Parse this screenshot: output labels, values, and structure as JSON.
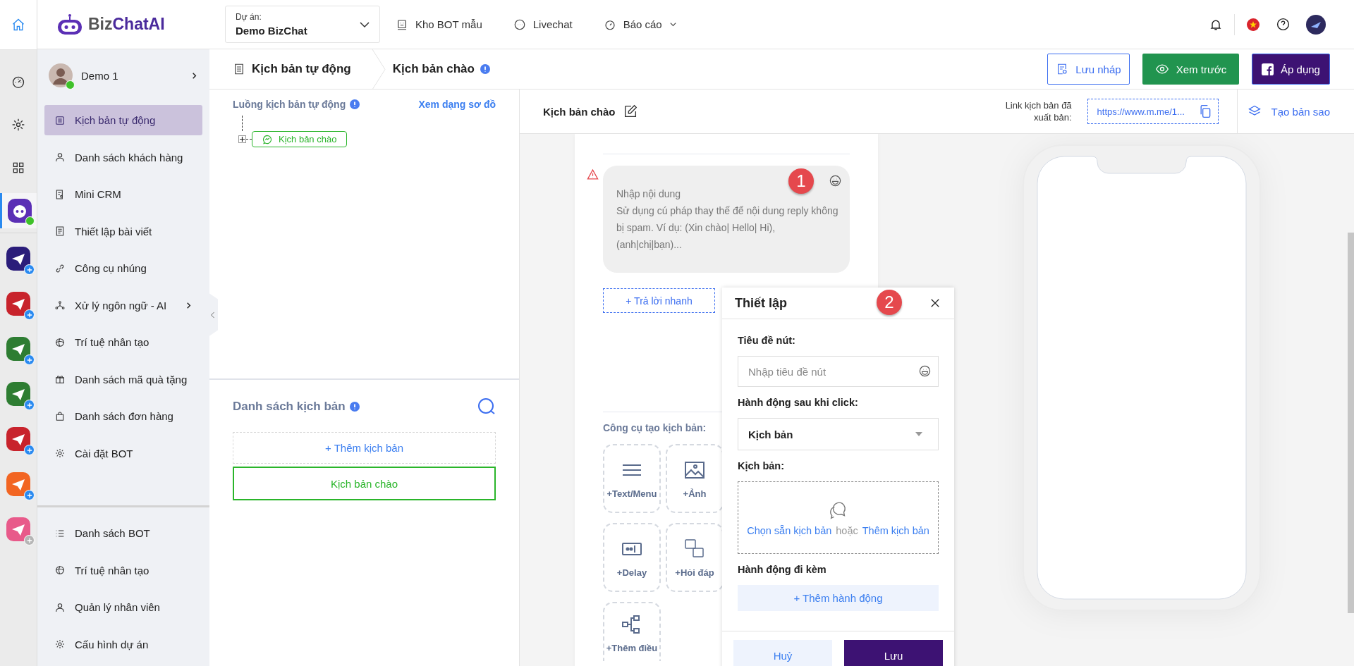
{
  "top_bar": {
    "logo": {
      "part_1": "Biz",
      "part_2": "ChatAI"
    },
    "project": {
      "label": "Dự án:",
      "value": "Demo BizChat"
    },
    "nav": [
      {
        "label": "Kho BOT mẫu",
        "has_menu": false
      },
      {
        "label": "Livechat",
        "has_menu": false
      },
      {
        "label": "Báo cáo",
        "has_menu": true
      }
    ]
  },
  "rail": {
    "tools": [
      {
        "selected": true
      },
      {
        "selected": false
      },
      {
        "selected": false
      },
      {
        "selected": false
      }
    ],
    "apps": [
      {
        "color": "#5b2fb5",
        "selected": true,
        "kind": "online"
      },
      {
        "color": "#2b1d7a",
        "selected": false,
        "kind": "add"
      },
      {
        "color": "#c8232c",
        "selected": false,
        "kind": "add"
      },
      {
        "color": "#2e7d32",
        "selected": false,
        "kind": "add"
      },
      {
        "color": "#2e7d32",
        "selected": false,
        "kind": "add"
      },
      {
        "color": "#c8232c",
        "selected": false,
        "kind": "add"
      },
      {
        "color": "#f26522",
        "selected": false,
        "kind": "add"
      },
      {
        "color": "#e85a8a",
        "selected": false,
        "kind": "disabled"
      }
    ]
  },
  "sidebar": {
    "user": {
      "name": "Demo 1",
      "online": true
    },
    "items": [
      {
        "label": "Kịch bản tự động",
        "selected": true,
        "has_submenu": false
      },
      {
        "label": "Danh sách khách hàng",
        "selected": false,
        "has_submenu": false
      },
      {
        "label": "Mini CRM",
        "selected": false,
        "has_submenu": false
      },
      {
        "label": "Thiết lập bài viết",
        "selected": false,
        "has_submenu": false
      },
      {
        "label": "Công cụ nhúng",
        "selected": false,
        "has_submenu": false
      },
      {
        "label": "Xử lý ngôn ngữ - AI",
        "selected": false,
        "has_submenu": true
      },
      {
        "label": "Trí tuệ nhân tạo",
        "selected": false,
        "has_submenu": false
      },
      {
        "label": "Danh sách mã quà tặng",
        "selected": false,
        "has_submenu": false
      },
      {
        "label": "Danh sách đơn hàng",
        "selected": false,
        "has_submenu": false
      },
      {
        "label": "Cài đặt BOT",
        "selected": false,
        "has_submenu": false
      }
    ],
    "bottom_items": [
      {
        "label": "Danh sách BOT",
        "selected": false
      },
      {
        "label": "Trí tuệ nhân tạo",
        "selected": false
      },
      {
        "label": "Quản lý nhân viên",
        "selected": false
      },
      {
        "label": "Cấu hình dự án",
        "selected": false
      }
    ]
  },
  "breadcrumb": [
    "Kịch bản tự động",
    "Kịch bản chào"
  ],
  "actions": [
    {
      "label": "Lưu nháp",
      "kind": "draft"
    },
    {
      "label": "Xem trước",
      "kind": "preview"
    },
    {
      "label": "Áp dụng",
      "kind": "apply"
    }
  ],
  "flow_panel": {
    "title": "Luồng kịch bản tự động",
    "view_link": "Xem dạng sơ đồ",
    "nodes": [
      {
        "label": "Kịch bản chào"
      }
    ]
  },
  "script_list": {
    "title": "Danh sách kịch bản",
    "add_label": "+ Thêm kịch bản",
    "items": [
      {
        "label": "Kịch bản chào",
        "selected": true
      }
    ]
  },
  "editor": {
    "title": "Kịch bản chào",
    "link_label": "Link kịch bản đã xuất bản:",
    "link_value": "https://www.m.me/1...",
    "copy_label": "Tạo bản sao",
    "message": {
      "placeholder": "Nhập nội dung\nSử dụng cú pháp thay thế để nội dung reply không bị spam. Ví dụ: (Xin chào| Hello| Hi), (anh|chị|bạn)...",
      "warning": true,
      "marker": "1"
    },
    "quick_reply": "+ Trả lời nhanh",
    "tools_title": "Công cụ tạo kịch bản:",
    "tools": [
      {
        "label": "+Text/Menu"
      },
      {
        "label": "+Ảnh"
      },
      {
        "label": "+Delay"
      },
      {
        "label": "+Hỏi đáp"
      },
      {
        "label": "+Thêm điều"
      }
    ]
  },
  "dialog": {
    "title": "Thiết lập",
    "marker": "2",
    "button_title_label": "Tiêu đề nút:",
    "button_title_placeholder": "Nhập tiêu đề nút",
    "action_label": "Hành động sau khi click:",
    "action_value": "Kịch bản",
    "script_label": "Kịch bản:",
    "choose_link": "Chọn sẵn kịch bản",
    "or_text": "hoặc",
    "add_link": "Thêm kịch bản",
    "extra_label": "Hành động đi kèm",
    "add_action": "+ Thêm hành động",
    "cancel": "Huỷ",
    "save": "Lưu"
  }
}
